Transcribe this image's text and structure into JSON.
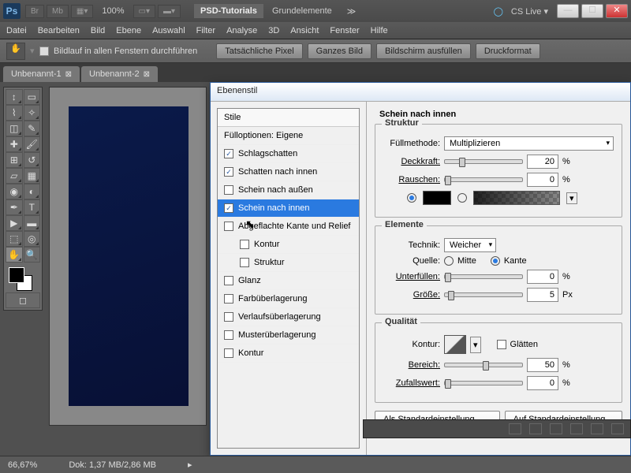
{
  "app": {
    "logo": "Ps"
  },
  "titlebar_buttons": [
    "Br",
    "Mb"
  ],
  "zoom_title": "100%",
  "titlebar_tabs": {
    "active": "PSD-Tutorials",
    "inactive": "Grundelemente"
  },
  "cslive": "CS Live",
  "menu": [
    "Datei",
    "Bearbeiten",
    "Bild",
    "Ebene",
    "Auswahl",
    "Filter",
    "Analyse",
    "3D",
    "Ansicht",
    "Fenster",
    "Hilfe"
  ],
  "optionsbar": {
    "scroll_all": "Bildlauf in allen Fenstern durchführen",
    "buttons": [
      "Tatsächliche Pixel",
      "Ganzes Bild",
      "Bildschirm ausfüllen",
      "Druckformat"
    ]
  },
  "tabs": [
    "Unbenannt-1",
    "Unbenannt-2"
  ],
  "dialog": {
    "title": "Ebenenstil",
    "styles_header": "Stile",
    "fill_opts": "Fülloptionen: Eigene",
    "items": [
      {
        "label": "Schlagschatten",
        "checked": true
      },
      {
        "label": "Schatten nach innen",
        "checked": true
      },
      {
        "label": "Schein nach außen",
        "checked": false
      },
      {
        "label": "Schein nach innen",
        "checked": true,
        "selected": true
      },
      {
        "label": "Abgeflachte Kante und Relief",
        "checked": false
      },
      {
        "label": "Kontur",
        "checked": false,
        "sub": true
      },
      {
        "label": "Struktur",
        "checked": false,
        "sub": true
      },
      {
        "label": "Glanz",
        "checked": false
      },
      {
        "label": "Farbüberlagerung",
        "checked": false
      },
      {
        "label": "Verlaufsüberlagerung",
        "checked": false
      },
      {
        "label": "Musterüberlagerung",
        "checked": false
      },
      {
        "label": "Kontur",
        "checked": false
      }
    ],
    "section_title": "Schein nach innen",
    "struktur": {
      "title": "Struktur",
      "blend_label": "Füllmethode:",
      "blend_value": "Multiplizieren",
      "opacity_label": "Deckkraft:",
      "opacity_value": "20",
      "opacity_unit": "%",
      "noise_label": "Rauschen:",
      "noise_value": "0",
      "noise_unit": "%"
    },
    "elemente": {
      "title": "Elemente",
      "technik_label": "Technik:",
      "technik_value": "Weicher",
      "quelle_label": "Quelle:",
      "mitte": "Mitte",
      "kante": "Kante",
      "unterfullen_label": "Unterfüllen:",
      "unterfullen_value": "0",
      "unterfullen_unit": "%",
      "grosse_label": "Größe:",
      "grosse_value": "5",
      "grosse_unit": "Px"
    },
    "qualitat": {
      "title": "Qualität",
      "kontur_label": "Kontur:",
      "glatten": "Glätten",
      "bereich_label": "Bereich:",
      "bereich_value": "50",
      "bereich_unit": "%",
      "zufall_label": "Zufallswert:",
      "zufall_value": "0",
      "zufall_unit": "%"
    },
    "btn_default": "Als Standardeinstellung festlegen",
    "btn_reset": "Auf Standardeinstellung zurück"
  },
  "status": {
    "zoom": "66,67%",
    "doc": "Dok: 1,37 MB/2,86 MB"
  }
}
